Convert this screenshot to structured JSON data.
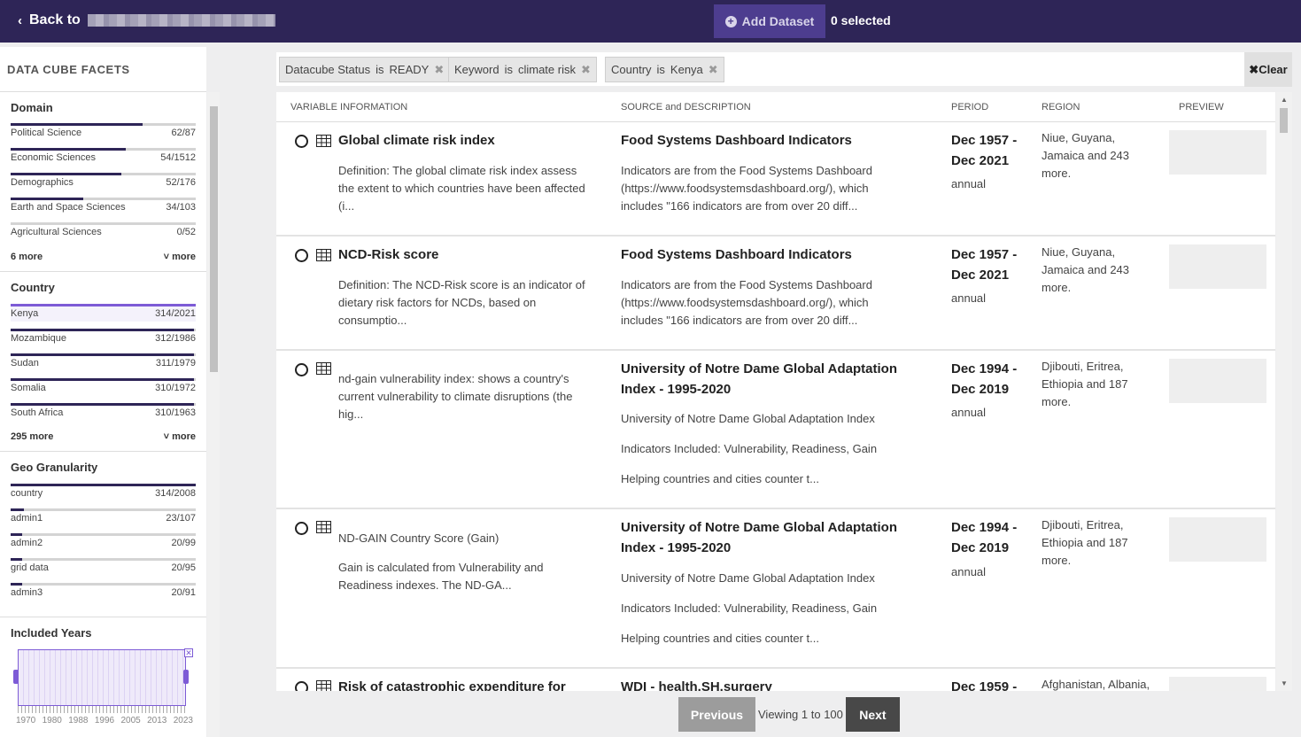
{
  "topbar": {
    "back_label": "Back to",
    "add_dataset_label": "Add Dataset",
    "selected_text": "0 selected"
  },
  "sidebar": {
    "header": "DATA CUBE FACETS",
    "domain": {
      "title": "Domain",
      "items": [
        {
          "label": "Political Science",
          "count": "62/87",
          "fraction": 0.713
        },
        {
          "label": "Economic Sciences",
          "count": "54/1512",
          "fraction": 0.62
        },
        {
          "label": "Demographics",
          "count": "52/176",
          "fraction": 0.6
        },
        {
          "label": "Earth and Space Sciences",
          "count": "34/103",
          "fraction": 0.39
        },
        {
          "label": "Agricultural Sciences",
          "count": "0/52",
          "fraction": 0
        }
      ],
      "more_count": "6 more",
      "more_toggle": "more"
    },
    "country": {
      "title": "Country",
      "items": [
        {
          "label": "Kenya",
          "count": "314/2021",
          "fraction": 1.0
        },
        {
          "label": "Mozambique",
          "count": "312/1986",
          "fraction": 0.99
        },
        {
          "label": "Sudan",
          "count": "311/1979",
          "fraction": 0.99
        },
        {
          "label": "Somalia",
          "count": "310/1972",
          "fraction": 0.99
        },
        {
          "label": "South Africa",
          "count": "310/1963",
          "fraction": 0.99
        }
      ],
      "more_count": "295 more",
      "more_toggle": "more"
    },
    "geo": {
      "title": "Geo Granularity",
      "items": [
        {
          "label": "country",
          "count": "314/2008",
          "fraction": 1.0
        },
        {
          "label": "admin1",
          "count": "23/107",
          "fraction": 0.073
        },
        {
          "label": "admin2",
          "count": "20/99",
          "fraction": 0.064
        },
        {
          "label": "grid data",
          "count": "20/95",
          "fraction": 0.064
        },
        {
          "label": "admin3",
          "count": "20/91",
          "fraction": 0.064
        }
      ]
    },
    "years": {
      "title": "Included Years",
      "ticks": [
        "1970",
        "1980",
        "1988",
        "1996",
        "2005",
        "2013",
        "2023"
      ]
    }
  },
  "filters": [
    {
      "field": "Datacube Status",
      "op": "is",
      "value": "READY"
    },
    {
      "field": "Keyword",
      "op": "is",
      "value": "climate risk"
    },
    {
      "field": "Country",
      "op": "is",
      "value": "Kenya"
    }
  ],
  "clear_label": "Clear",
  "table": {
    "headers": [
      "VARIABLE INFORMATION",
      "SOURCE and DESCRIPTION",
      "PERIOD",
      "REGION",
      "PREVIEW"
    ],
    "rows": [
      {
        "title": "Global climate risk index",
        "subtitle": "",
        "desc": "Definition: The global climate risk index assess the extent to which countries have been affected (i...",
        "source": "Food Systems Dashboard Indicators",
        "source_desc": [
          "Indicators are from the Food Systems Dashboard (https://www.foodsystemsdashboard.org/), which includes \"166 indicators are from over 20 diff..."
        ],
        "period": "Dec 1957 - Dec 2021",
        "freq": "annual",
        "region": "Niue, Guyana, Jamaica and 243 more."
      },
      {
        "title": "NCD-Risk score",
        "subtitle": "",
        "desc": "Definition: The NCD-Risk score is an indicator of dietary risk factors for NCDs, based on consumptio...",
        "source": "Food Systems Dashboard Indicators",
        "source_desc": [
          "Indicators are from the Food Systems Dashboard (https://www.foodsystemsdashboard.org/), which includes \"166 indicators are from over 20 diff..."
        ],
        "period": "Dec 1957 - Dec 2021",
        "freq": "annual",
        "region": "Niue, Guyana, Jamaica and 243 more."
      },
      {
        "title": "",
        "subtitle": "",
        "desc": "nd-gain vulnerability index: shows a country's current vulnerability to climate disruptions (the hig...",
        "source": "University of Notre Dame Global Adaptation Index - 1995-2020",
        "source_desc": [
          "University of Notre Dame Global Adaptation Index",
          "Indicators Included: Vulnerability, Readiness, Gain",
          "Helping countries and cities counter t..."
        ],
        "period": "Dec 1994 - Dec 2019",
        "freq": "annual",
        "region": "Djibouti, Eritrea, Ethiopia and 187 more."
      },
      {
        "title": "",
        "subtitle": "ND-GAIN Country Score (Gain)",
        "desc": "Gain is calculated from Vulnerability and Readiness indexes. The ND-GA...",
        "source": "University of Notre Dame Global Adaptation Index - 1995-2020",
        "source_desc": [
          "University of Notre Dame Global Adaptation Index",
          "Indicators Included: Vulnerability, Readiness, Gain",
          "Helping countries and cities counter t..."
        ],
        "period": "Dec 1994 - Dec 2019",
        "freq": "annual",
        "region": "Djibouti, Eritrea, Ethiopia and 187 more."
      },
      {
        "title": "Risk of catastrophic expenditure for",
        "subtitle": "",
        "desc": "",
        "source": "WDI - health.SH.surgery",
        "source_desc": [],
        "period": "Dec 1959 -",
        "freq": "",
        "region": "Afghanistan, Albania,"
      }
    ]
  },
  "pager": {
    "prev_label": "Previous",
    "viewing_text": "Viewing 1 to 100",
    "next_label": "Next"
  },
  "colors": {
    "topbar_bg": "#2e2557",
    "accent": "#7d5bd6",
    "bar_dark": "#2e2557"
  }
}
